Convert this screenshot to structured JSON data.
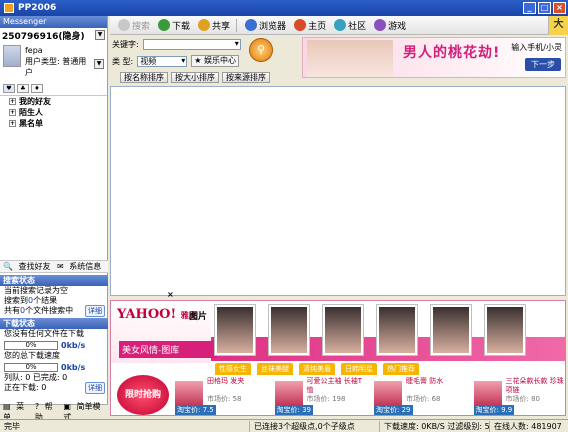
{
  "window": {
    "title": "PP2006"
  },
  "messenger": {
    "header": "Messenger",
    "user_id": "250796916(隐身)",
    "nickname": "fepa",
    "user_type": "用户类型: 普通用户",
    "groups": [
      "我的好友",
      "陌生人",
      "黑名单"
    ]
  },
  "left_tools": {
    "find_friend": "查找好友",
    "system_msg": "系统信息"
  },
  "search_status": {
    "title": "搜索状态",
    "line1": "当前搜索记录为空",
    "line2_prefix": "搜索到",
    "line2_count": "0",
    "line2_suffix": "个结果",
    "line3_prefix": "共有",
    "line3_count": "0",
    "line3_suffix": "个文件搜索中",
    "detail": "详细"
  },
  "download_status": {
    "title": "下载状态",
    "line1": "您没有任何文件在下载",
    "progress1": "0%",
    "progress1_value": 0,
    "unit1": "0kb/s",
    "line2": "您的总下载速度",
    "progress2": "0%",
    "progress2_value": 0,
    "unit2": "0kb/s",
    "line3": "列队: 0  已完成: 0",
    "line4": "正在下载: 0",
    "detail": "详细"
  },
  "left_footer": {
    "menu": "菜单",
    "help": "帮助",
    "simple": "简单模式"
  },
  "toolbar": {
    "search": "搜索",
    "download": "下载",
    "share": "共享",
    "browser": "浏览器",
    "home": "主页",
    "community": "社区",
    "game": "游戏"
  },
  "search_form": {
    "keyword_label": "关键字:",
    "keyword_value": "",
    "type_label": "类 型:",
    "type_value": "视频",
    "ent_center": "娱乐中心",
    "sort_name": "按名称排序",
    "sort_size": "按大小排序",
    "sort_source": "按来源排序"
  },
  "banner_top": {
    "title": "男人的桃花劫!",
    "side": "输入手机/小灵",
    "next": "下一步"
  },
  "ad": {
    "brand": "YAHOO!",
    "brand_sub": "雅虎",
    "section": "图片",
    "caption": "美女风情-图库",
    "tabs": [
      "性感女生",
      "丝袜美腿",
      "清纯美眉",
      "日韩明星",
      "热门推荐"
    ],
    "promo": "限时抢购",
    "products": [
      {
        "name": "田格玛 发夹",
        "market": "市场价: 58",
        "price": "淘宝价: 7.5"
      },
      {
        "name": "可爱公主袖 长袖T恤",
        "market": "市场价: 198",
        "price": "淘宝价: 39"
      },
      {
        "name": "睫毛膏 防水",
        "market": "市场价: 68",
        "price": "淘宝价: 29"
      },
      {
        "name": "三花朵款长款 珍珠项链",
        "market": "市场价: 80",
        "price": "淘宝价: 9.9"
      }
    ]
  },
  "statusbar": {
    "left": "完毕",
    "connection": "已连接3个超级点,0个子级点",
    "speed": "下载速度: 0KB/S 过滤级别: 5",
    "online": "在线人数: 481907"
  },
  "colors": {
    "title_blue": "#2b5fc8",
    "accent_pink": "#d8207a"
  }
}
